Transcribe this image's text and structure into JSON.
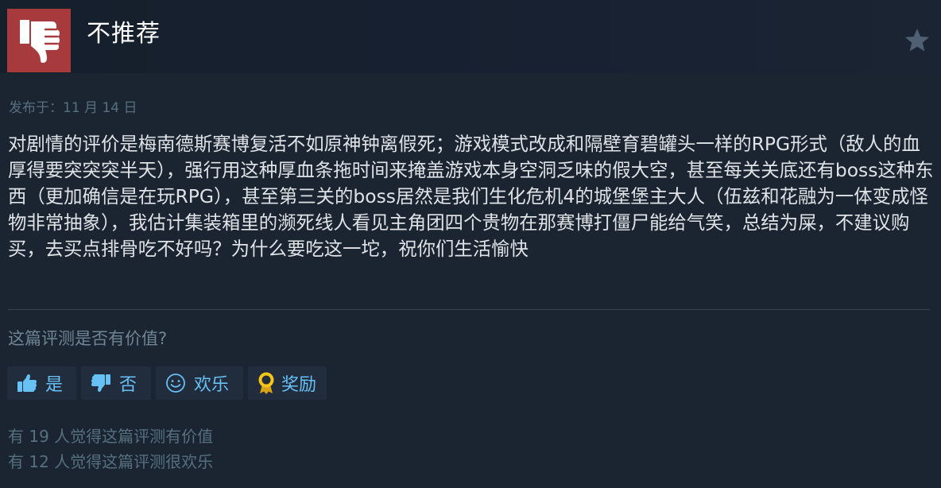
{
  "review": {
    "verdict": "不推荐",
    "vote_icon": "thumbs-down-icon",
    "favorite_icon": "star-icon",
    "posted": "发布于：11 月 14 日",
    "body": "对剧情的评价是梅南德斯赛博复活不如原神钟离假死；游戏模式改成和隔壁育碧罐头一样的RPG形式（敌人的血厚得要突突突半天），强行用这种厚血条拖时间来掩盖游戏本身空洞乏味的假大空，甚至每关关底还有boss这种东西（更加确信是在玩RPG），甚至第三关的boss居然是我们生化危机4的城堡堡主大人（伍兹和花融为一体变成怪物非常抽象），我估计集装箱里的濒死线人看见主角团四个贵物在那赛博打僵尸能给气笑，总结为屎，不建议购买，去买点排骨吃不好吗？为什么要吃这一坨，祝你们生活愉快"
  },
  "feedback": {
    "question": "这篇评测是否有价值?",
    "buttons": {
      "yes": {
        "label": "是",
        "icon": "thumbs-up-icon"
      },
      "no": {
        "label": "否",
        "icon": "thumbs-down-icon"
      },
      "funny": {
        "label": "欢乐",
        "icon": "smiley-icon"
      },
      "award": {
        "label": "奖励",
        "icon": "award-ribbon-icon"
      }
    },
    "helpful_count_text": "有 19 人觉得这篇评测有价值",
    "funny_count_text": "有 12 人觉得这篇评测很欢乐"
  },
  "colors": {
    "background": "#1b2431",
    "negative_vote": "#a63a3d",
    "link_blue": "#67c1f5",
    "award_gold": "#f5c518"
  }
}
